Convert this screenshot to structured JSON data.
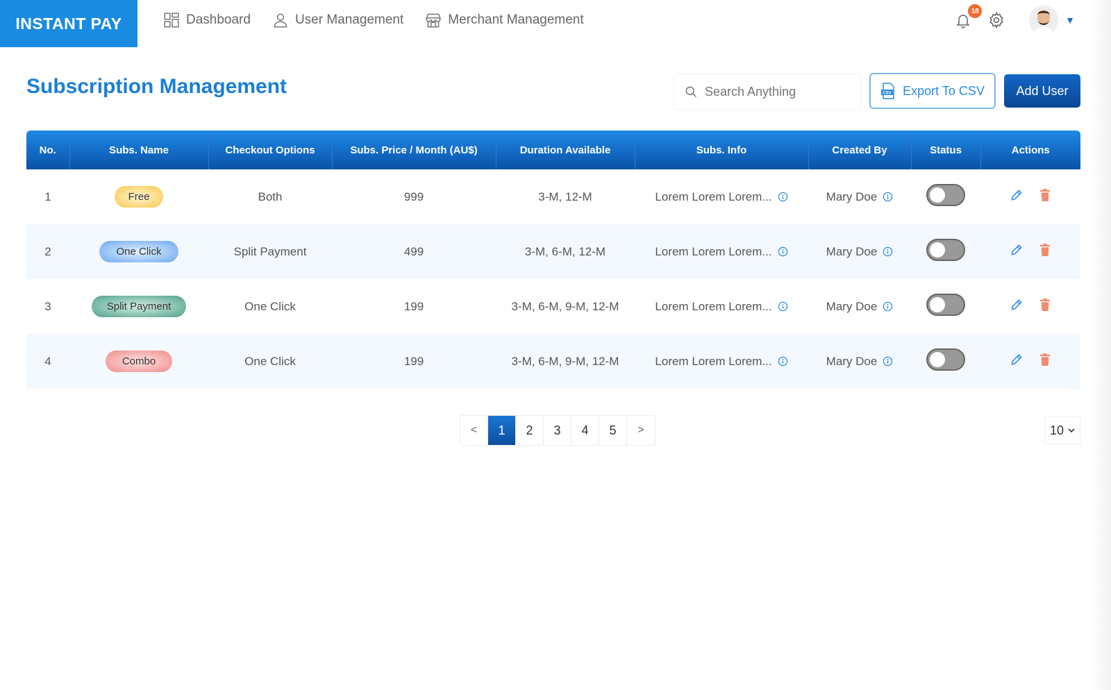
{
  "brand": "INSTANT PAY",
  "nav": [
    {
      "label": "Dashboard",
      "icon": "dashboard-icon"
    },
    {
      "label": "User Management",
      "icon": "user-icon"
    },
    {
      "label": "Merchant Management",
      "icon": "store-icon"
    }
  ],
  "notifications": {
    "count": "18",
    "icon": "bell-icon"
  },
  "settings_icon": "gear-icon",
  "page_title": "Subscription Management",
  "search": {
    "placeholder": "Search Anything"
  },
  "export_label": "Export To CSV",
  "add_label": "Add User",
  "table": {
    "headers": [
      "No.",
      "Subs. Name",
      "Checkout Options",
      "Subs. Price / Month (AU$)",
      "Duration Available",
      "Subs. Info",
      "Created By",
      "Status",
      "Actions"
    ],
    "rows": [
      {
        "no": "1",
        "name": "Free",
        "checkout": "Both",
        "price": "999",
        "duration": "3-M, 12-M",
        "info": "Lorem Lorem Lorem...",
        "created_by": "Mary Doe"
      },
      {
        "no": "2",
        "name": "One Click",
        "checkout": "Split Payment",
        "price": "499",
        "duration": "3-M, 6-M, 12-M",
        "info": "Lorem Lorem Lorem...",
        "created_by": "Mary Doe"
      },
      {
        "no": "3",
        "name": "Split Payment",
        "checkout": "One Click",
        "price": "199",
        "duration": "3-M, 6-M, 9-M, 12-M",
        "info": "Lorem Lorem Lorem...",
        "created_by": "Mary Doe"
      },
      {
        "no": "4",
        "name": "Combo",
        "checkout": "One Click",
        "price": "199",
        "duration": "3-M, 6-M, 9-M, 12-M",
        "info": "Lorem Lorem Lorem...",
        "created_by": "Mary Doe"
      }
    ]
  },
  "pagination": {
    "prev": "<",
    "pages": [
      "1",
      "2",
      "3",
      "4",
      "5"
    ],
    "active": "1",
    "next": ">"
  },
  "per_page": "10",
  "colors": {
    "brand": "#1a8be0",
    "header_dark": "#0a52a8",
    "edit": "#2a8ae0",
    "delete": "#f08a70"
  }
}
